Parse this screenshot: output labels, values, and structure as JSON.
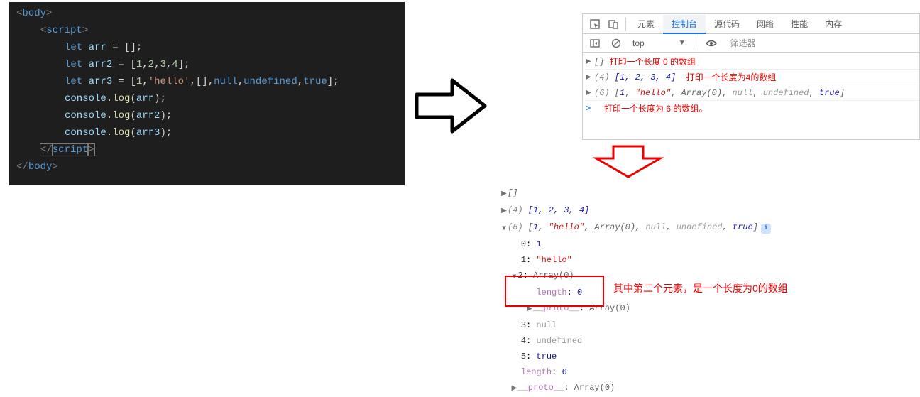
{
  "editor": {
    "lines": {
      "body_open": "body",
      "script_open": "script",
      "let": "let",
      "arr": "arr",
      "arr2": "arr2",
      "arr3": "arr3",
      "eq": " = ",
      "brk_open": "[",
      "brk_close": "]",
      "semi": ";",
      "nums": {
        "n1": "1",
        "n2": "2",
        "n3": "3",
        "n4": "4"
      },
      "str_hello": "'hello'",
      "null": "null",
      "undefined": "undefined",
      "true": "true",
      "console": "console",
      "log": "log",
      "script_close": "script",
      "body_close": "body"
    }
  },
  "devtools": {
    "tabs": {
      "elements": "元素",
      "console": "控制台",
      "sources": "源代码",
      "network": "网络",
      "performance": "性能",
      "memory": "内存"
    },
    "toolbar": {
      "scope": "top",
      "filter_placeholder": "筛选器"
    },
    "logs": {
      "row1_prefix": "[]",
      "row1_ann": "打印一个长度 0 的数组",
      "row2_count": "(4)",
      "row2_arr": " [1, 2, 3, 4]",
      "row2_ann": "打印一个长度为4的数组",
      "row3_count": "(6)",
      "row3_arr_pre": " [",
      "row3_n1": "1",
      "row3_s": "\"hello\"",
      "row3_arr0": "Array(0)",
      "row3_null": "null",
      "row3_undef": "undefined",
      "row3_true": "true",
      "row3_arr_suf": "]",
      "row4_ann": "打印一个长度为 6 的数组。"
    }
  },
  "expanded": {
    "l1": "[]",
    "l2_count": "(4)",
    "l2_arr": " [1, 2, 3, 4]",
    "l3_count": "(6)",
    "l3_seq": " [1, \"hello\", Array(0), null, undefined, true]",
    "idx0": "0",
    "v0": "1",
    "idx1": "1",
    "v1": "\"hello\"",
    "idx2": "2",
    "v2": "Array(0)",
    "len_lbl": "length",
    "len_val2": "0",
    "proto": "__proto__",
    "proto_val": "Array(0)",
    "idx3": "3",
    "v3": "null",
    "idx4": "4",
    "v4": "undefined",
    "idx5": "5",
    "v5": "true",
    "len6_lbl": "length",
    "len6_val": "6",
    "ann6": "其中第二个元素，是一个长度为0的数组"
  }
}
